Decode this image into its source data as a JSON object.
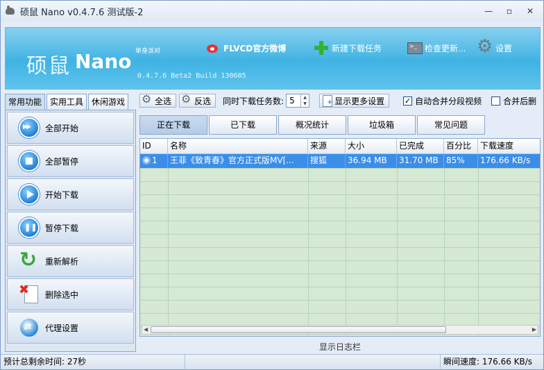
{
  "window": {
    "title": "硕鼠 Nano v0.4.7.6 测试版-2"
  },
  "banner": {
    "logo_cn": "硕鼠",
    "logo_en": "Nano",
    "tagline": "单身派对",
    "version": "0.4.7.6 Beta2  Build 130605",
    "links": {
      "weibo": "FLVCD官方微博",
      "new_task": "新建下载任务",
      "check_update": "检查更新...",
      "settings": "设置"
    }
  },
  "left_tabs": [
    "常用功能",
    "实用工具",
    "休闲游戏"
  ],
  "side_buttons": {
    "start_all": "全部开始",
    "pause_all": "全部暂停",
    "start": "开始下载",
    "pause": "暂停下载",
    "reparse": "重新解析",
    "delete": "删除选中",
    "proxy": "代理设置"
  },
  "toolbar": {
    "select_all": "全选",
    "invert": "反选",
    "concurrent_label": "同时下载任务数:",
    "concurrent_value": "5",
    "more_settings": "显示更多设置",
    "auto_merge": "自动合并分段视频",
    "merge_delete": "合并后删"
  },
  "right_tabs": [
    "正在下载",
    "已下载",
    "概况统计",
    "垃圾箱",
    "常见问题"
  ],
  "table": {
    "headers": [
      "ID",
      "名称",
      "来源",
      "大小",
      "已完成",
      "百分比",
      "下载速度"
    ],
    "rows": [
      {
        "id": "1",
        "name": "王菲《致青春》官方正式版MV[...",
        "source": "搜狐",
        "size": "36.94 MB",
        "done": "31.70 MB",
        "percent": "85%",
        "speed": "176.66 KB/s"
      }
    ]
  },
  "log_label": "显示日志栏",
  "status": {
    "remaining": "预计总剩余时间:  27秒",
    "speed": "瞬间速度: 176.66 KB/s"
  }
}
